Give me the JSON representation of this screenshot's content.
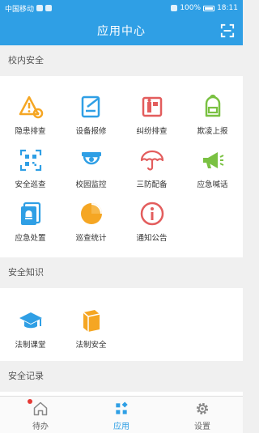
{
  "status_bar": {
    "carrier": "中国移动",
    "battery": "100%",
    "time": "18:11"
  },
  "header": {
    "title": "应用中心",
    "scan_icon": "scan-icon"
  },
  "sections": {
    "campus_safety": {
      "title": "校内安全",
      "items": [
        {
          "label": "隐患排查",
          "icon": "hazard-gear-icon"
        },
        {
          "label": "设备报修",
          "icon": "repair-note-icon"
        },
        {
          "label": "纠纷排查",
          "icon": "dispute-board-icon"
        },
        {
          "label": "欺凌上报",
          "icon": "backpack-icon"
        },
        {
          "label": "安全巡查",
          "icon": "qr-code-icon"
        },
        {
          "label": "校园监控",
          "icon": "camera-icon"
        },
        {
          "label": "三防配备",
          "icon": "umbrella-icon"
        },
        {
          "label": "应急喊话",
          "icon": "megaphone-icon"
        },
        {
          "label": "应急处置",
          "icon": "alert-doc-icon"
        },
        {
          "label": "巡查统计",
          "icon": "pie-chart-icon"
        },
        {
          "label": "通知公告",
          "icon": "info-icon"
        }
      ]
    },
    "safety_knowledge": {
      "title": "安全知识",
      "items": [
        {
          "label": "法制课堂",
          "icon": "graduation-cap-icon"
        },
        {
          "label": "法制安全",
          "icon": "book-icon"
        }
      ]
    },
    "safety_records": {
      "title": "安全记录"
    }
  },
  "tabbar": {
    "items": [
      {
        "label": "待办",
        "icon": "home-icon",
        "badge": true
      },
      {
        "label": "应用",
        "icon": "apps-grid-icon",
        "active": true
      },
      {
        "label": "设置",
        "icon": "gear-icon"
      }
    ]
  },
  "colors": {
    "primary": "#2f9fe5",
    "orange": "#f5a623",
    "red": "#e35d5d",
    "green": "#7ac142"
  }
}
